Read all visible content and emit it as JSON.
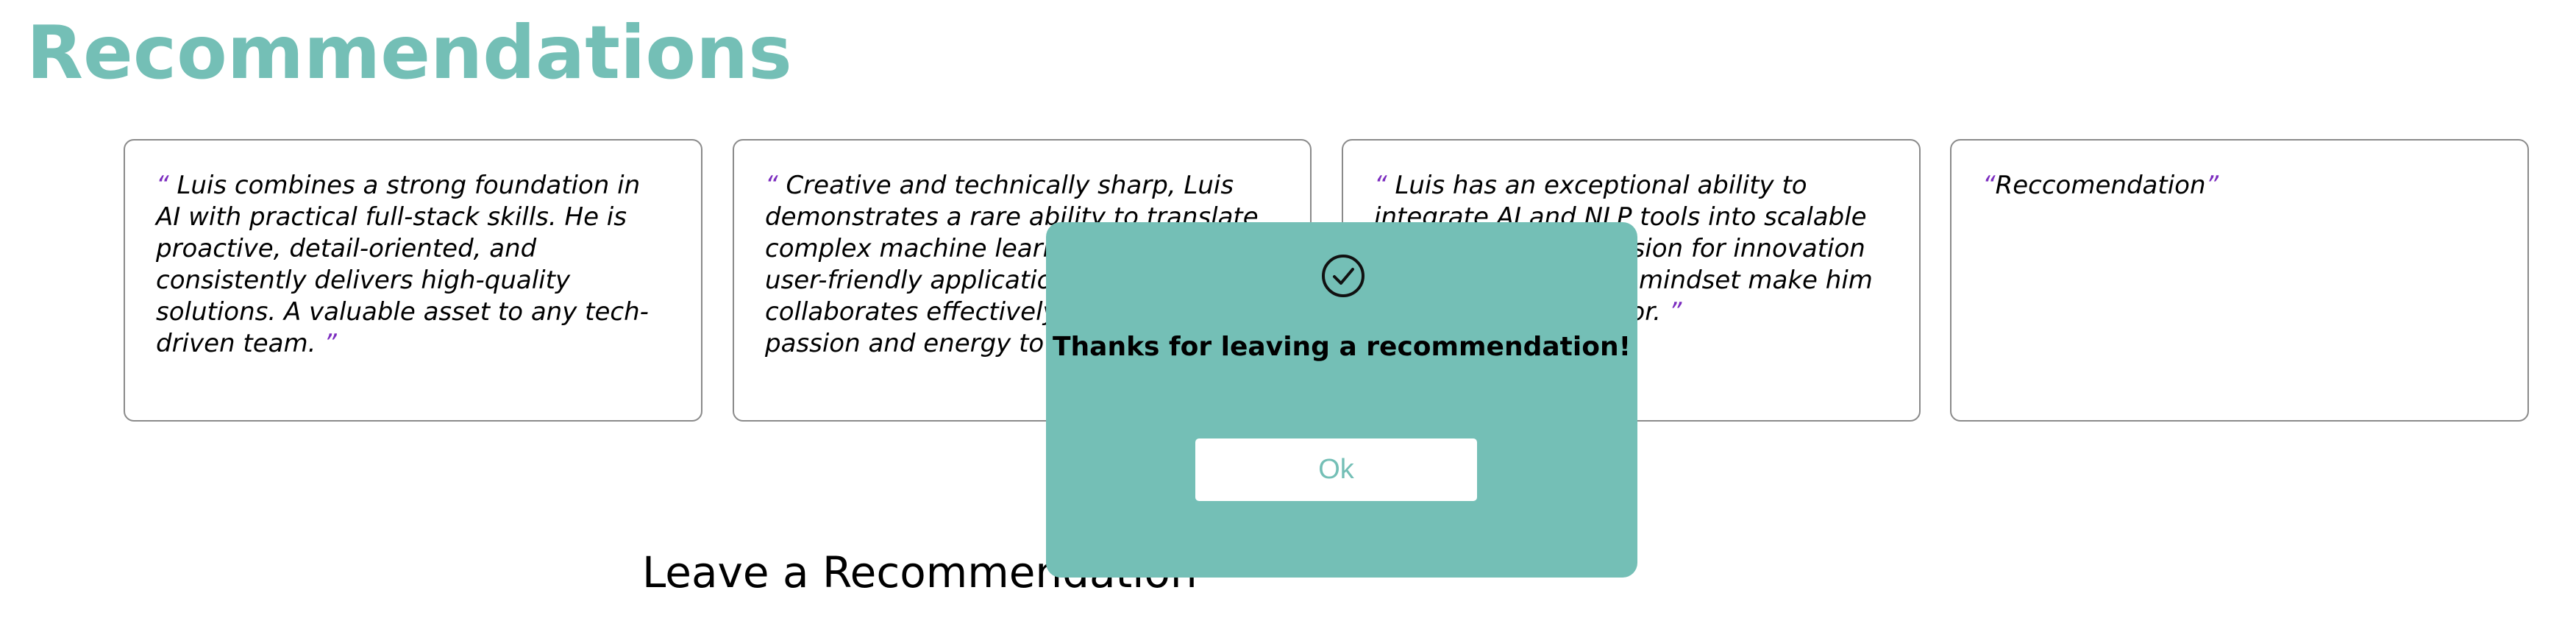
{
  "page": {
    "title": "Recommendations",
    "accent_color": "#74bfb6",
    "quote_mark_color": "#7b2cbf"
  },
  "recommendations": [
    {
      "open_quote": "“",
      "text": "Luis combines a strong foundation in AI with practical full-stack skills. He is proactive, detail-oriented, and consistently delivers high-quality solutions. A valuable asset to any tech-driven team.",
      "close_quote": "”"
    },
    {
      "open_quote": "“",
      "text": "Creative and technically sharp, Luis demonstrates a rare ability to translate complex machine learning concepts into user-friendly applications. He collaborates effectively and brings both passion and energy to team projects.",
      "close_quote": "”"
    },
    {
      "open_quote": "“",
      "text": "Luis has an exceptional ability to integrate AI and NLP tools into scalable applications. His passion for innovation and problem-solving mindset make him a standout contributor.",
      "close_quote": "”"
    },
    {
      "open_quote": "“",
      "text": "Reccomendation",
      "close_quote": "”"
    }
  ],
  "form": {
    "heading": "Leave a Recommendation"
  },
  "modal": {
    "icon": "check-circle-icon",
    "message": "Thanks for leaving a recommendation!",
    "ok_label": "Ok"
  }
}
